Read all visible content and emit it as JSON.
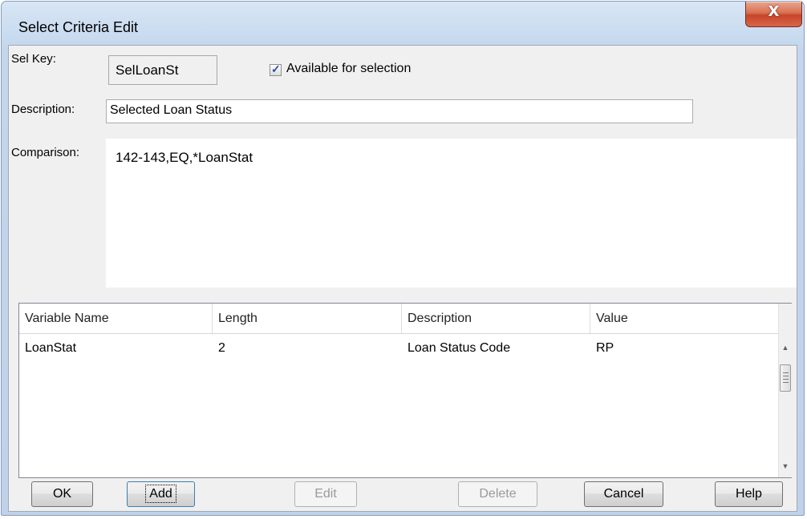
{
  "window": {
    "title": "Select Criteria Edit",
    "close_glyph": "X"
  },
  "form": {
    "sel_key_label": "Sel Key:",
    "sel_key_value": "SelLoanSt",
    "available_label": "Available for selection",
    "available_checked": true,
    "description_label": "Description:",
    "description_value": "Selected Loan Status",
    "comparison_label": "Comparison:",
    "comparison_value": "142-143,EQ,*LoanStat"
  },
  "grid": {
    "columns": [
      "Variable Name",
      "Length",
      "Description",
      "Value"
    ],
    "rows": [
      [
        "LoanStat",
        "2",
        "Loan Status Code",
        "RP"
      ]
    ]
  },
  "buttons": {
    "ok": "OK",
    "add": "Add",
    "edit": "Edit",
    "delete": "Delete",
    "cancel": "Cancel",
    "help": "Help"
  },
  "icons": {
    "close": "close-icon",
    "check": "checkmark-icon",
    "scroll_up": "scroll-up-arrow-icon",
    "scroll_down": "scroll-down-arrow-icon"
  },
  "colors": {
    "close_button": "#c7442a",
    "title_bar": "#cadcf0",
    "client_bg": "#f0f0f0"
  }
}
